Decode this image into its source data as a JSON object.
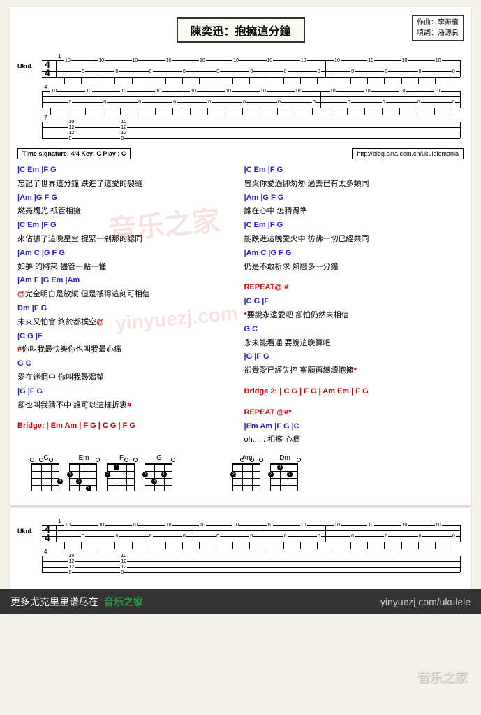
{
  "title": "陳奕迅：抱擁這分鐘",
  "credits": {
    "composer_label": "作曲：",
    "composer": "李振權",
    "lyricist_label": "填詞：",
    "lyricist": "潘源良"
  },
  "instrument_label": "Ukul.",
  "meta": {
    "text": "Time signature: 4/4    Key:  C    Play :  C",
    "link": "http://blog.sina.com.cn/ukulelemania"
  },
  "chord_data": {
    "tab_pattern": [
      10,
      0,
      10,
      0,
      10,
      0,
      10,
      0
    ],
    "time_sig": "4/4"
  },
  "left_col": [
    {
      "c": "|C                Em  |F                    G",
      "l": "忘記了世界這分鐘  跌進了這愛的裂縫"
    },
    {
      "c": "|Am          |G    F  G",
      "l": "燃亮燭光  祇管相擁"
    },
    {
      "c": "|C                Em  |F                    G",
      "l": "來佔據了這晚星空  捉緊一剎那的認同"
    },
    {
      "c": "|Am          C      |G    F  G",
      "l": "如夢 的將來 儘管一點一懂"
    },
    {
      "c": "|Am        F         |G       Em       |Am",
      "l": "@完全明白是放縱  但是祇得這刻可相信",
      "pre": "   "
    },
    {
      "c": "          Dm      |F            G",
      "l": "   未來又怕會 終於都撲空@"
    },
    {
      "c": "|C               G              |F",
      "l": "#你叫我最快樂你也叫我最心痛"
    },
    {
      "c": " G                C",
      "l": "     愛在迷惘中 你叫我最渴望"
    },
    {
      "c": "|G               |F      G",
      "l": "卻也叫我猜不中 誰可以這樣折衷#"
    },
    {
      "bridge": "Bridge: | Em Am  | F  G  | C G  | F  G"
    }
  ],
  "right_col": [
    {
      "c": "|C                Em  |F                       G",
      "l": "曾與你愛過卻匆匆 過去已有太多類同"
    },
    {
      "c": "|Am          |G    F  G",
      "l": "誰在心中 怎猜得準"
    },
    {
      "c": "|C                Em  |F                    G",
      "l": "能跌進這晚愛火中  彷彿一切已經共同"
    },
    {
      "c": "|Am          C      |G    F  G",
      "l": "仍是不敢祈求 熱戀多一分鐘"
    },
    {
      "repeat": "REPEAT@ #"
    },
    {
      "c": "   |C                 G              |F",
      "l": "*要說永遠愛吧 卻怕仍然未相信"
    },
    {
      "c": " G                         C",
      "l": "   永未能看通 要說這晚算吧"
    },
    {
      "c": "|G                          |F         G",
      "l": "卻覺愛已經失控 寧願再繼續抱擁*"
    },
    {
      "bridge": "Bridge 2: | C  G  | F   G  | Am  Em | F  G"
    },
    {
      "repeat": "REPEAT @#*"
    },
    {
      "c": "|Em  Am   |F        G       |C",
      "l": "oh......               相擁  心痛"
    }
  ],
  "chords": [
    {
      "name": "C",
      "dots": [
        {
          "s": 4,
          "f": 3,
          "n": "3"
        }
      ],
      "open": [
        1,
        2,
        3
      ]
    },
    {
      "name": "Em",
      "dots": [
        {
          "s": 1,
          "f": 2,
          "n": "1"
        },
        {
          "s": 2,
          "f": 3,
          "n": "2"
        },
        {
          "s": 3,
          "f": 4,
          "n": "3"
        }
      ],
      "open": [
        4
      ]
    },
    {
      "name": "F",
      "dots": [
        {
          "s": 2,
          "f": 1,
          "n": "1"
        },
        {
          "s": 1,
          "f": 2,
          "n": "2"
        }
      ],
      "open": [
        3,
        4
      ]
    },
    {
      "name": "G",
      "dots": [
        {
          "s": 3,
          "f": 2,
          "n": "1"
        },
        {
          "s": 1,
          "f": 2,
          "n": "2"
        },
        {
          "s": 2,
          "f": 3,
          "n": "3"
        }
      ],
      "open": [
        4
      ]
    },
    {
      "name": "Am",
      "dots": [
        {
          "s": 1,
          "f": 2,
          "n": "2"
        }
      ],
      "open": [
        2,
        3,
        4
      ],
      "offset": true
    },
    {
      "name": "Dm",
      "dots": [
        {
          "s": 2,
          "f": 1,
          "n": "1"
        },
        {
          "s": 1,
          "f": 2,
          "n": "2"
        },
        {
          "s": 3,
          "f": 2,
          "n": "2"
        }
      ],
      "open": [
        4
      ],
      "offset": true
    }
  ],
  "footer": {
    "more": "更多尤克里里谱尽在",
    "brand": "音乐之家",
    "url": "yinyuezj.com/ukulele"
  },
  "wm": "音乐之家",
  "wm2": "yinyuezj.com"
}
